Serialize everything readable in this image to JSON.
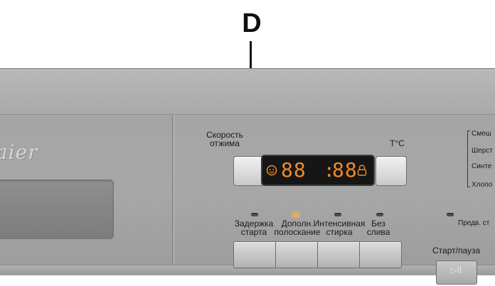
{
  "callout": {
    "letter": "D"
  },
  "brand": {
    "text": "aier"
  },
  "labels": {
    "spin_speed_line1": "Скорость",
    "spin_speed_line2": "отжима",
    "temperature": "T°C",
    "pre_wash": "Предв. ст",
    "start_pause": "Старт/пауза"
  },
  "display": {
    "left_digits": "88",
    "right_digits": "88"
  },
  "options": [
    {
      "line1": "Задержка",
      "line2": "старта",
      "led_on": false
    },
    {
      "line1": "Дополн.",
      "line2": "полоскание",
      "led_on": true
    },
    {
      "line1": "Интенсивная",
      "line2": "стирка",
      "led_on": false
    },
    {
      "line1": "Без",
      "line2": "слива",
      "led_on": false
    }
  ],
  "programs": [
    "Смеш",
    "Шерст",
    "Синте",
    "Хлопо"
  ],
  "colors": {
    "led_on": "#f2a63a",
    "display_digits": "#ef8a2c",
    "panel": "#a7a7a7"
  },
  "icons": {
    "face": "face-icon",
    "lock": "lock-icon",
    "play_pause": "play-pause-icon"
  }
}
